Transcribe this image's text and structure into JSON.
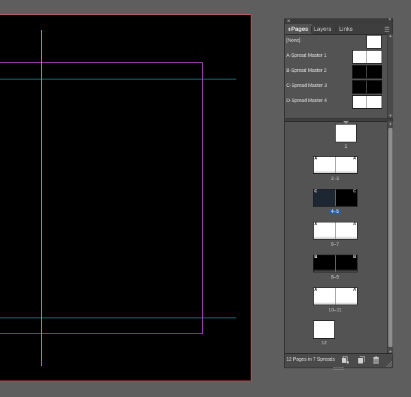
{
  "panel": {
    "tabs": [
      {
        "label": "Pages"
      },
      {
        "label": "Layers"
      },
      {
        "label": "Links"
      }
    ],
    "masters": [
      {
        "label": "[None]",
        "style": "white",
        "single": true
      },
      {
        "label": "A-Spread Master 1",
        "style": "white"
      },
      {
        "label": "B-Spread Master 2",
        "style": "black"
      },
      {
        "label": "C-Spread Master 3",
        "style": "black"
      },
      {
        "label": "D-Spread Master 4",
        "style": "white"
      }
    ],
    "spreads": [
      {
        "label": "1",
        "master": "",
        "style": "white",
        "pages": 1
      },
      {
        "label": "2–3",
        "master": "A",
        "style": "white",
        "pages": 2
      },
      {
        "label": "4–5",
        "master": "C",
        "style": "selected",
        "pages": 2,
        "selected": true
      },
      {
        "label": "6–7",
        "master": "A",
        "style": "white",
        "pages": 2
      },
      {
        "label": "8–9",
        "master": "B",
        "style": "black",
        "pages": 2
      },
      {
        "label": "10–11",
        "master": "A",
        "style": "white",
        "pages": 2
      },
      {
        "label": "12",
        "master": "",
        "style": "white",
        "pages": 1
      }
    ],
    "footer_text": "12 Pages in 7 Spreads"
  },
  "colors": {
    "pasteboard": "#5e5e5e",
    "guide": "#21c4d6",
    "margin": "#b43fc9",
    "bleed": "#d95b5b",
    "panel_bg": "#535353",
    "selection": "#2f5d9a"
  }
}
